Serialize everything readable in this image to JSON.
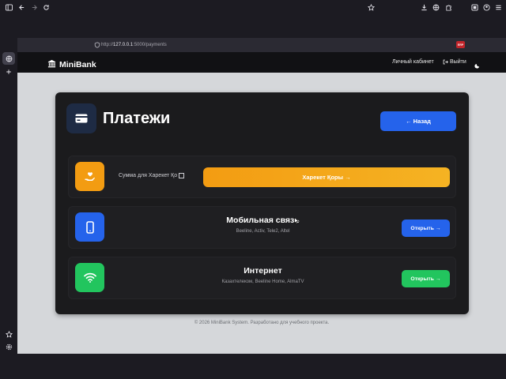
{
  "browser": {
    "url_prefix": "http://",
    "url_host": "127.0.0.1",
    "url_path": ":5000/payments",
    "ext_badge": "ERP"
  },
  "nav": {
    "brand": "MiniBank",
    "cabinet_link": "Личный кабинет",
    "logout_link": "Выйти"
  },
  "page": {
    "title": "Платежи",
    "back_label": "← Назад",
    "payment_row": {
      "amount_label": "Сумма для Харекет Қо",
      "pay_button": "Харекет Қоры →"
    },
    "services": [
      {
        "title": "Мобильная связь",
        "subtitle": "Beeline, Activ, Tele2, Altel",
        "button": "Открыть →",
        "color": "#2563eb"
      },
      {
        "title": "Интернет",
        "subtitle": "Казахтелеком, Beeline Home, AlmaTV",
        "button": "Открыть →",
        "color": "#22c55e"
      }
    ],
    "footer": "© 2026 MiniBank System. Разработано для учебного проекта."
  },
  "colors": {
    "accent_blue": "#2563eb",
    "accent_orange": "#f39c12",
    "accent_green": "#22c55e",
    "card_bg": "#1b1b1d"
  }
}
